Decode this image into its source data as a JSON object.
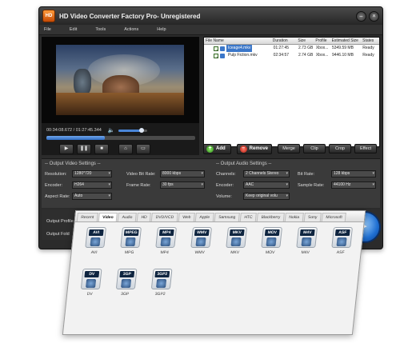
{
  "window": {
    "title": "HD Video Converter Factory Pro- Unregistered",
    "logo_text": "HD"
  },
  "menu": [
    "File",
    "Edit",
    "Tools",
    "Actions",
    "Help"
  ],
  "player": {
    "time": "00:34:08.672 / 01:27:45.344",
    "progress": 0.39,
    "volume": 0.82
  },
  "filelist": {
    "headers": [
      "File Name",
      "Duration",
      "Size",
      "Profile",
      "Estimated Size",
      "States"
    ],
    "rows": [
      {
        "name": "Iceage4.mkv",
        "duration": "01:27:45",
        "size": "2.73 GB",
        "profile": "Xbox...",
        "est": "5349.59 MB",
        "state": "Ready",
        "selected": true
      },
      {
        "name": "Pulp Fiction.mkv",
        "duration": "02:34:57",
        "size": "2.74 GB",
        "profile": "Xbox...",
        "est": "9446.10 MB",
        "state": "Ready",
        "selected": false
      }
    ]
  },
  "actions": {
    "add": "Add",
    "remove": "Remove",
    "merge": "Merge",
    "clip": "Clip",
    "crop": "Crop",
    "effect": "Effect"
  },
  "video_settings": {
    "title": "Output Video Settings",
    "resolution_label": "Resolution:",
    "resolution": "1280*720",
    "bitrate_label": "Video Bit Rate:",
    "bitrate": "8000 kbps",
    "encoder_label": "Encoder:",
    "encoder": "H264",
    "framerate_label": "Frame Rate:",
    "framerate": "30 fps",
    "aspect_label": "Aspect Rate:",
    "aspect": "Auto"
  },
  "audio_settings": {
    "title": "Output Audio Settings",
    "channels_label": "Channels:",
    "channels": "2 Channels Stereo",
    "abitrate_label": "Bit Rate:",
    "abitrate": "128 kbps",
    "encoder_label": "Encoder:",
    "encoder": "AAC",
    "samplerate_label": "Sample Rate:",
    "samplerate": "44100 Hz",
    "volume_label": "Volume:",
    "volume": "Keep original volu"
  },
  "bottom": {
    "profile_label": "Output Profile",
    "folder_label": "Output Fold"
  },
  "profile_tabs": [
    "Recent",
    "Video",
    "Audio",
    "HD",
    "DVD/VCD",
    "Web",
    "Apple",
    "Samsung",
    "HTC",
    "Blackberry",
    "Nokia",
    "Sony",
    "Microsoft"
  ],
  "active_tab": "Video",
  "formats": [
    {
      "label": "AVI",
      "icon_text": "AVI"
    },
    {
      "label": "MPG",
      "icon_text": "MPEG"
    },
    {
      "label": "MP4",
      "icon_text": "MP4"
    },
    {
      "label": "WMV",
      "icon_text": "WMV"
    },
    {
      "label": "MKV",
      "icon_text": "MKV"
    },
    {
      "label": "MOV",
      "icon_text": "MOV"
    },
    {
      "label": "M4V",
      "icon_text": "M4V"
    },
    {
      "label": "ASF",
      "icon_text": "ASF"
    },
    {
      "label": "DV",
      "icon_text": "DV"
    },
    {
      "label": "3GP",
      "icon_text": "3GP"
    },
    {
      "label": "3GP2",
      "icon_text": "3GP2"
    }
  ],
  "colors": {
    "accent": "#3b77c9",
    "panel": "#2b2b2b",
    "add_green": "#2a8a12",
    "remove_red": "#b0180c"
  }
}
